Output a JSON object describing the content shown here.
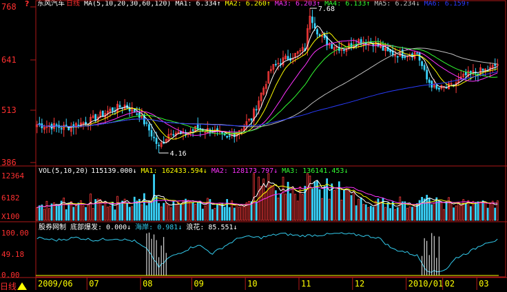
{
  "colors": {
    "bg": "#000000",
    "frame": "#b01818",
    "axis_text": "#ff3030",
    "up": "#ff3b3b",
    "down": "#3ad6ff",
    "ma1": "#ffffff",
    "ma2": "#ffff00",
    "ma3": "#ff33ff",
    "ma4": "#33ff33",
    "ma5": "#c0c0c0",
    "ma6": "#2a3cff",
    "haian": "#33ccee",
    "langhua": "#ffffff",
    "dibu": "#ffff00",
    "date_bar": "#ffff00"
  },
  "price_panel": {
    "stock_name": "东风汽车",
    "period": "日线",
    "ma_params": "MA(5,10,20,30,60,120)",
    "ma1": "MA1: 6.334↑",
    "ma2": "MA2: 6.260↑",
    "ma3": "MA3: 6.203↑",
    "ma4": "MA4: 6.133↑",
    "ma5": "MA5: 6.234↓",
    "ma6": "MA6: 6.159↑",
    "high_label": "7.68",
    "low_label": "4.16"
  },
  "vol_panel": {
    "params": "VOL(5,10,20)",
    "value": "115139.000↓",
    "ma1": "MA1: 162433.594↓",
    "ma2": "MA2: 128173.797↓",
    "ma3": "MA3: 136141.453↓",
    "unit": "X100"
  },
  "ind_panel": {
    "name": "股券网制",
    "dibu": "底部爆发: 0.000↓",
    "haian": "海岸: 0.981↓",
    "langhua": "浪花: 85.551↓"
  },
  "footer": {
    "period_button": "日线",
    "date_labels": [
      "2009/06",
      "07",
      "08",
      "09",
      "10",
      "11",
      "12",
      "2010/01",
      "02",
      "03"
    ]
  },
  "chart_data": {
    "type": "candlestick",
    "price_axis_ticks": [
      "768",
      "641",
      "513",
      "386"
    ],
    "price_range": [
      3.86,
      7.68
    ],
    "volume_axis_ticks": [
      "12364",
      "6182",
      "X100"
    ],
    "volume_range": [
      0,
      12364
    ],
    "indicator_axis_ticks": [
      "100.00",
      "49.18",
      "0.00"
    ],
    "indicator_range": [
      0,
      100
    ],
    "sessions": 190,
    "series_names": [
      "MA1",
      "MA2",
      "MA3",
      "MA4",
      "MA5",
      "MA6"
    ],
    "close_anchors": [
      [
        0,
        4.85
      ],
      [
        12,
        4.78
      ],
      [
        22,
        4.95
      ],
      [
        30,
        5.2
      ],
      [
        36,
        5.32
      ],
      [
        42,
        5.1
      ],
      [
        46,
        4.72
      ],
      [
        50,
        4.3
      ],
      [
        55,
        4.7
      ],
      [
        60,
        4.6
      ],
      [
        65,
        4.75
      ],
      [
        72,
        4.7
      ],
      [
        78,
        4.5
      ],
      [
        84,
        4.78
      ],
      [
        88,
        5.0
      ],
      [
        92,
        5.6
      ],
      [
        96,
        6.2
      ],
      [
        100,
        6.4
      ],
      [
        106,
        6.55
      ],
      [
        110,
        6.7
      ],
      [
        112,
        7.55
      ],
      [
        116,
        7.0
      ],
      [
        120,
        6.8
      ],
      [
        126,
        6.7
      ],
      [
        132,
        6.9
      ],
      [
        138,
        6.85
      ],
      [
        144,
        6.6
      ],
      [
        150,
        6.55
      ],
      [
        156,
        6.6
      ],
      [
        160,
        5.95
      ],
      [
        164,
        5.7
      ],
      [
        170,
        5.78
      ],
      [
        176,
        6.05
      ],
      [
        182,
        6.15
      ],
      [
        186,
        6.2
      ],
      [
        189,
        6.33
      ]
    ],
    "ma_periods": [
      5,
      10,
      20,
      30,
      60,
      120
    ],
    "high_point": {
      "index": 112,
      "value": 7.68
    },
    "low_point": {
      "index": 50,
      "value": 4.16
    },
    "volume_peak": 12364,
    "haian_anchors": [
      [
        0,
        85
      ],
      [
        8,
        80
      ],
      [
        16,
        86
      ],
      [
        24,
        80
      ],
      [
        32,
        84
      ],
      [
        40,
        78
      ],
      [
        46,
        55
      ],
      [
        50,
        18
      ],
      [
        54,
        40
      ],
      [
        60,
        55
      ],
      [
        66,
        70
      ],
      [
        72,
        50
      ],
      [
        78,
        70
      ],
      [
        84,
        88
      ],
      [
        92,
        86
      ],
      [
        100,
        95
      ],
      [
        108,
        90
      ],
      [
        116,
        92
      ],
      [
        124,
        95
      ],
      [
        132,
        92
      ],
      [
        140,
        86
      ],
      [
        146,
        60
      ],
      [
        150,
        55
      ],
      [
        156,
        45
      ],
      [
        160,
        12
      ],
      [
        164,
        8
      ],
      [
        168,
        15
      ],
      [
        172,
        40
      ],
      [
        178,
        55
      ],
      [
        184,
        75
      ],
      [
        189,
        80
      ]
    ],
    "langhua_spike_ranges": [
      [
        45,
        53
      ],
      [
        158,
        165
      ]
    ],
    "date_label_indices": [
      0,
      21,
      43,
      64,
      86,
      108,
      130,
      152,
      167,
      181
    ]
  }
}
